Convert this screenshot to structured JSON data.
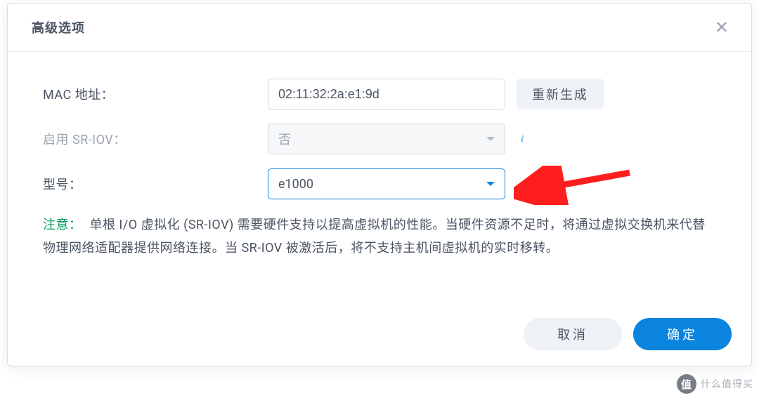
{
  "dialog": {
    "title": "高级选项"
  },
  "form": {
    "mac": {
      "label": "MAC 地址：",
      "value": "02:11:32:2a:e1:9d",
      "regenerate_label": "重新生成"
    },
    "sriov": {
      "label": "启用 SR-IOV：",
      "value": "否"
    },
    "model": {
      "label": "型号：",
      "value": "e1000"
    }
  },
  "note": {
    "label": "注意：",
    "text": "单根 I/O 虚拟化 (SR-IOV) 需要硬件支持以提高虚拟机的性能。当硬件资源不足时，将通过虚拟交换机来代替物理网络适配器提供网络连接。当 SR-IOV 被激活后，将不支持主机间虚拟机的实时移转。"
  },
  "footer": {
    "cancel": "取消",
    "confirm": "确定"
  },
  "watermark": {
    "badge": "值",
    "text": "什么值得买"
  }
}
